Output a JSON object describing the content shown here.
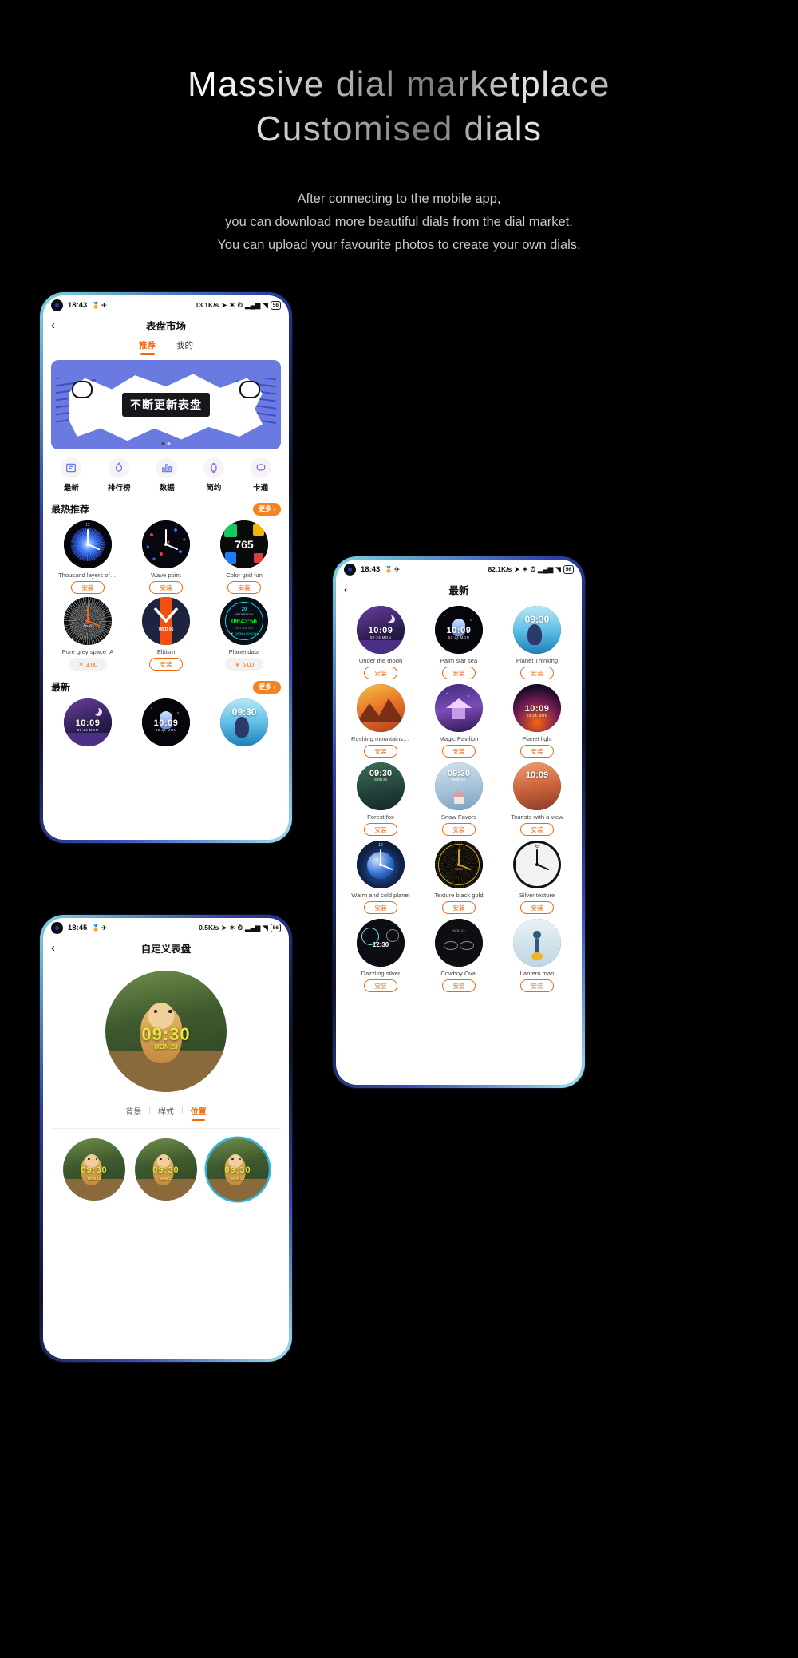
{
  "hero": {
    "title_line1": "Massive dial marketplace",
    "title_line2": "Customised dials",
    "sub_line1": "After connecting to the mobile app,",
    "sub_line2": "you can download more beautiful dials from the dial market.",
    "sub_line3": "You can upload your favourite photos to create your own dials."
  },
  "colors": {
    "accent": "#f2660c",
    "more_btn": "#f7811e",
    "banner_bg": "#6b7ae0",
    "select_ring": "#2fb6e8"
  },
  "phone1": {
    "status": {
      "time": "18:43",
      "network": "13.1K/s",
      "battery": "56",
      "icons": [
        "location-icon",
        "bluetooth-icon",
        "alarm-icon",
        "signal-icon",
        "wifi-icon"
      ]
    },
    "nav": {
      "back": "‹",
      "title": "表盘市场"
    },
    "tabs": [
      {
        "label": "推荐",
        "active": true
      },
      {
        "label": "我的",
        "active": false
      }
    ],
    "banner": {
      "text": "不断更新表盘"
    },
    "categories": [
      {
        "label": "最新",
        "icon": "newspaper-icon"
      },
      {
        "label": "排行榜",
        "icon": "flame-icon"
      },
      {
        "label": "数据",
        "icon": "bar-chart-icon"
      },
      {
        "label": "简约",
        "icon": "watch-icon"
      },
      {
        "label": "卡通",
        "icon": "cartoon-icon"
      }
    ],
    "section_hot": {
      "title": "最热推荐",
      "more": "更多 ›"
    },
    "section_new": {
      "title": "最新",
      "more": "更多 ›"
    },
    "hot_dials": [
      {
        "name": "Thousand layers of fl…",
        "action": "安装",
        "type": "install",
        "style": "burst-blue"
      },
      {
        "name": "Wave point",
        "action": "安装",
        "type": "install",
        "style": "dots-red"
      },
      {
        "name": "Color grid fun",
        "action": "安装",
        "type": "install",
        "style": "color-grid"
      },
      {
        "name": "Pure grey space_A",
        "action": "￥ 3.00",
        "type": "price",
        "style": "grey-space"
      },
      {
        "name": "Elitism",
        "action": "安装",
        "type": "install",
        "style": "elitism"
      },
      {
        "name": "Planet data",
        "action": "￥ 6.00",
        "type": "price",
        "style": "planet-data"
      }
    ],
    "new_dials": [
      {
        "name": "Under the moon",
        "style": "moon"
      },
      {
        "name": "Palm star sea",
        "style": "astro"
      },
      {
        "name": "Planet Thinking",
        "style": "surf"
      }
    ]
  },
  "phone2": {
    "status": {
      "time": "18:43",
      "network": "82.1K/s",
      "battery": "56"
    },
    "nav": {
      "back": "‹",
      "title": "最新"
    },
    "install_label": "安装",
    "dials": [
      {
        "name": "Under the moon",
        "time": "10:09",
        "date": "03·24  MON",
        "style": "moon"
      },
      {
        "name": "Palm star sea",
        "time": "10:09",
        "date": "03·24  MON",
        "style": "astro"
      },
      {
        "name": "Planet Thinking",
        "time": "09:30",
        "date": "",
        "style": "surf"
      },
      {
        "name": "Rushing mountains a…",
        "time": "",
        "date": "",
        "style": "mountain"
      },
      {
        "name": "Magic Pavilion",
        "time": "",
        "date": "",
        "style": "pavilion"
      },
      {
        "name": "Planet light",
        "time": "10:09",
        "date": "03·24  MON",
        "style": "planetlight"
      },
      {
        "name": "Forest fox",
        "time": "09:30",
        "date": "MON 23",
        "style": "forest"
      },
      {
        "name": "Snow Favors",
        "time": "09:30",
        "date": "MON 23",
        "style": "snow"
      },
      {
        "name": "Tourists with a view",
        "time": "10:09",
        "date": "",
        "style": "tourist"
      },
      {
        "name": "Warm and cold planet",
        "time": "",
        "date": "",
        "style": "warmcold"
      },
      {
        "name": "Texture black gold",
        "time": "",
        "date": "",
        "style": "blackgold"
      },
      {
        "name": "Silver texture",
        "time": "",
        "date": "",
        "style": "silver"
      },
      {
        "name": "Dazzling silver",
        "time": "12:30",
        "date": "",
        "style": "dazzling"
      },
      {
        "name": "Cowboy Oval",
        "time": "",
        "date": "",
        "style": "cowboy"
      },
      {
        "name": "Lantern man",
        "time": "",
        "date": "",
        "style": "lantern"
      }
    ]
  },
  "phone3": {
    "status": {
      "time": "18:45",
      "network": "0.5K/s",
      "battery": "56"
    },
    "nav": {
      "back": "‹",
      "title": "自定义表盘"
    },
    "preview": {
      "time": "09:30",
      "date": "MON 23"
    },
    "tabs": [
      {
        "label": "背景",
        "active": false
      },
      {
        "label": "样式",
        "active": false
      },
      {
        "label": "位置",
        "active": true
      }
    ],
    "thumbs": [
      {
        "selected": false,
        "time": "09:30"
      },
      {
        "selected": false,
        "time": "09:30"
      },
      {
        "selected": true,
        "time": "09:30"
      }
    ]
  }
}
